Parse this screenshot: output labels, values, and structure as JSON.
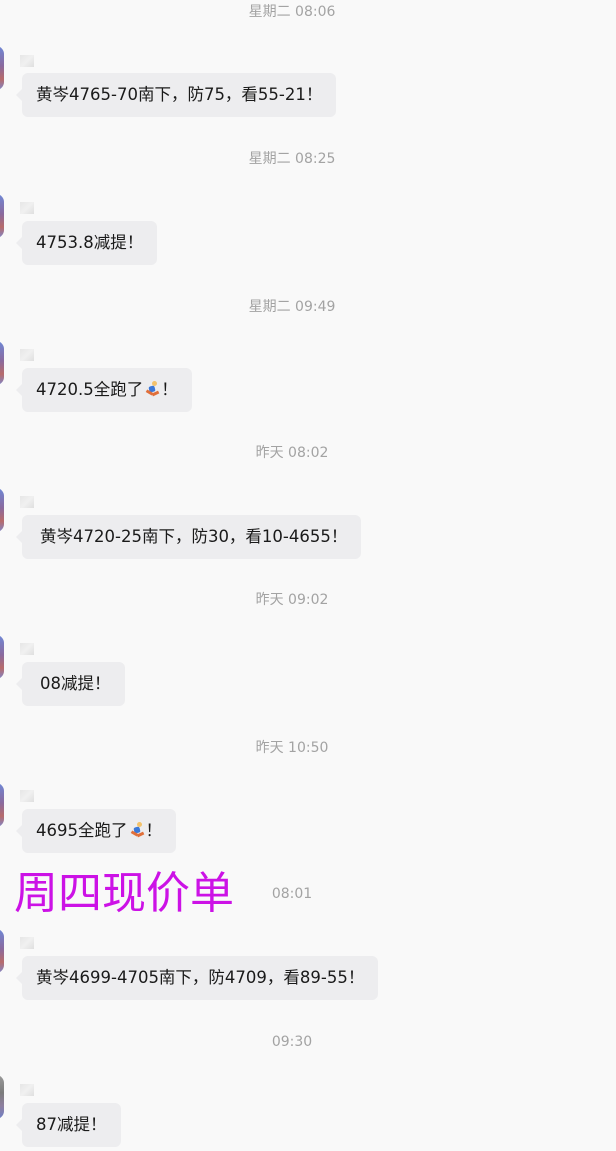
{
  "messages": [
    {
      "time": "星期二 08:06",
      "text": "黄岑4765-70南下，防75，看55-21！"
    },
    {
      "time": "星期二 08:25",
      "text": "4753.8减提！"
    },
    {
      "time": "星期二 09:49",
      "text_before": "4720.5全跑了",
      "emoji": "running-person-icon",
      "text_after": "！"
    },
    {
      "time": "昨天 08:02",
      "text": "黄岑4720-25南下，防30，看10-4655！"
    },
    {
      "time": "昨天 09:02",
      "text": "08减提！"
    },
    {
      "time": "昨天 10:50",
      "text_before": "4695全跑了",
      "emoji": "running-person-icon",
      "text_after": "！"
    },
    {
      "time": "08:01",
      "text": "黄岑4699-4705南下，防4709，看89-55！"
    },
    {
      "time": "09:30",
      "text": "87减提！"
    }
  ],
  "headline": {
    "text": "周四现价单",
    "color": "#cc12e6"
  },
  "colors": {
    "background": "#f9f9f9",
    "bubble": "#ededef",
    "timestamp": "#a3a3a3",
    "message_text": "#1a1a1a"
  }
}
